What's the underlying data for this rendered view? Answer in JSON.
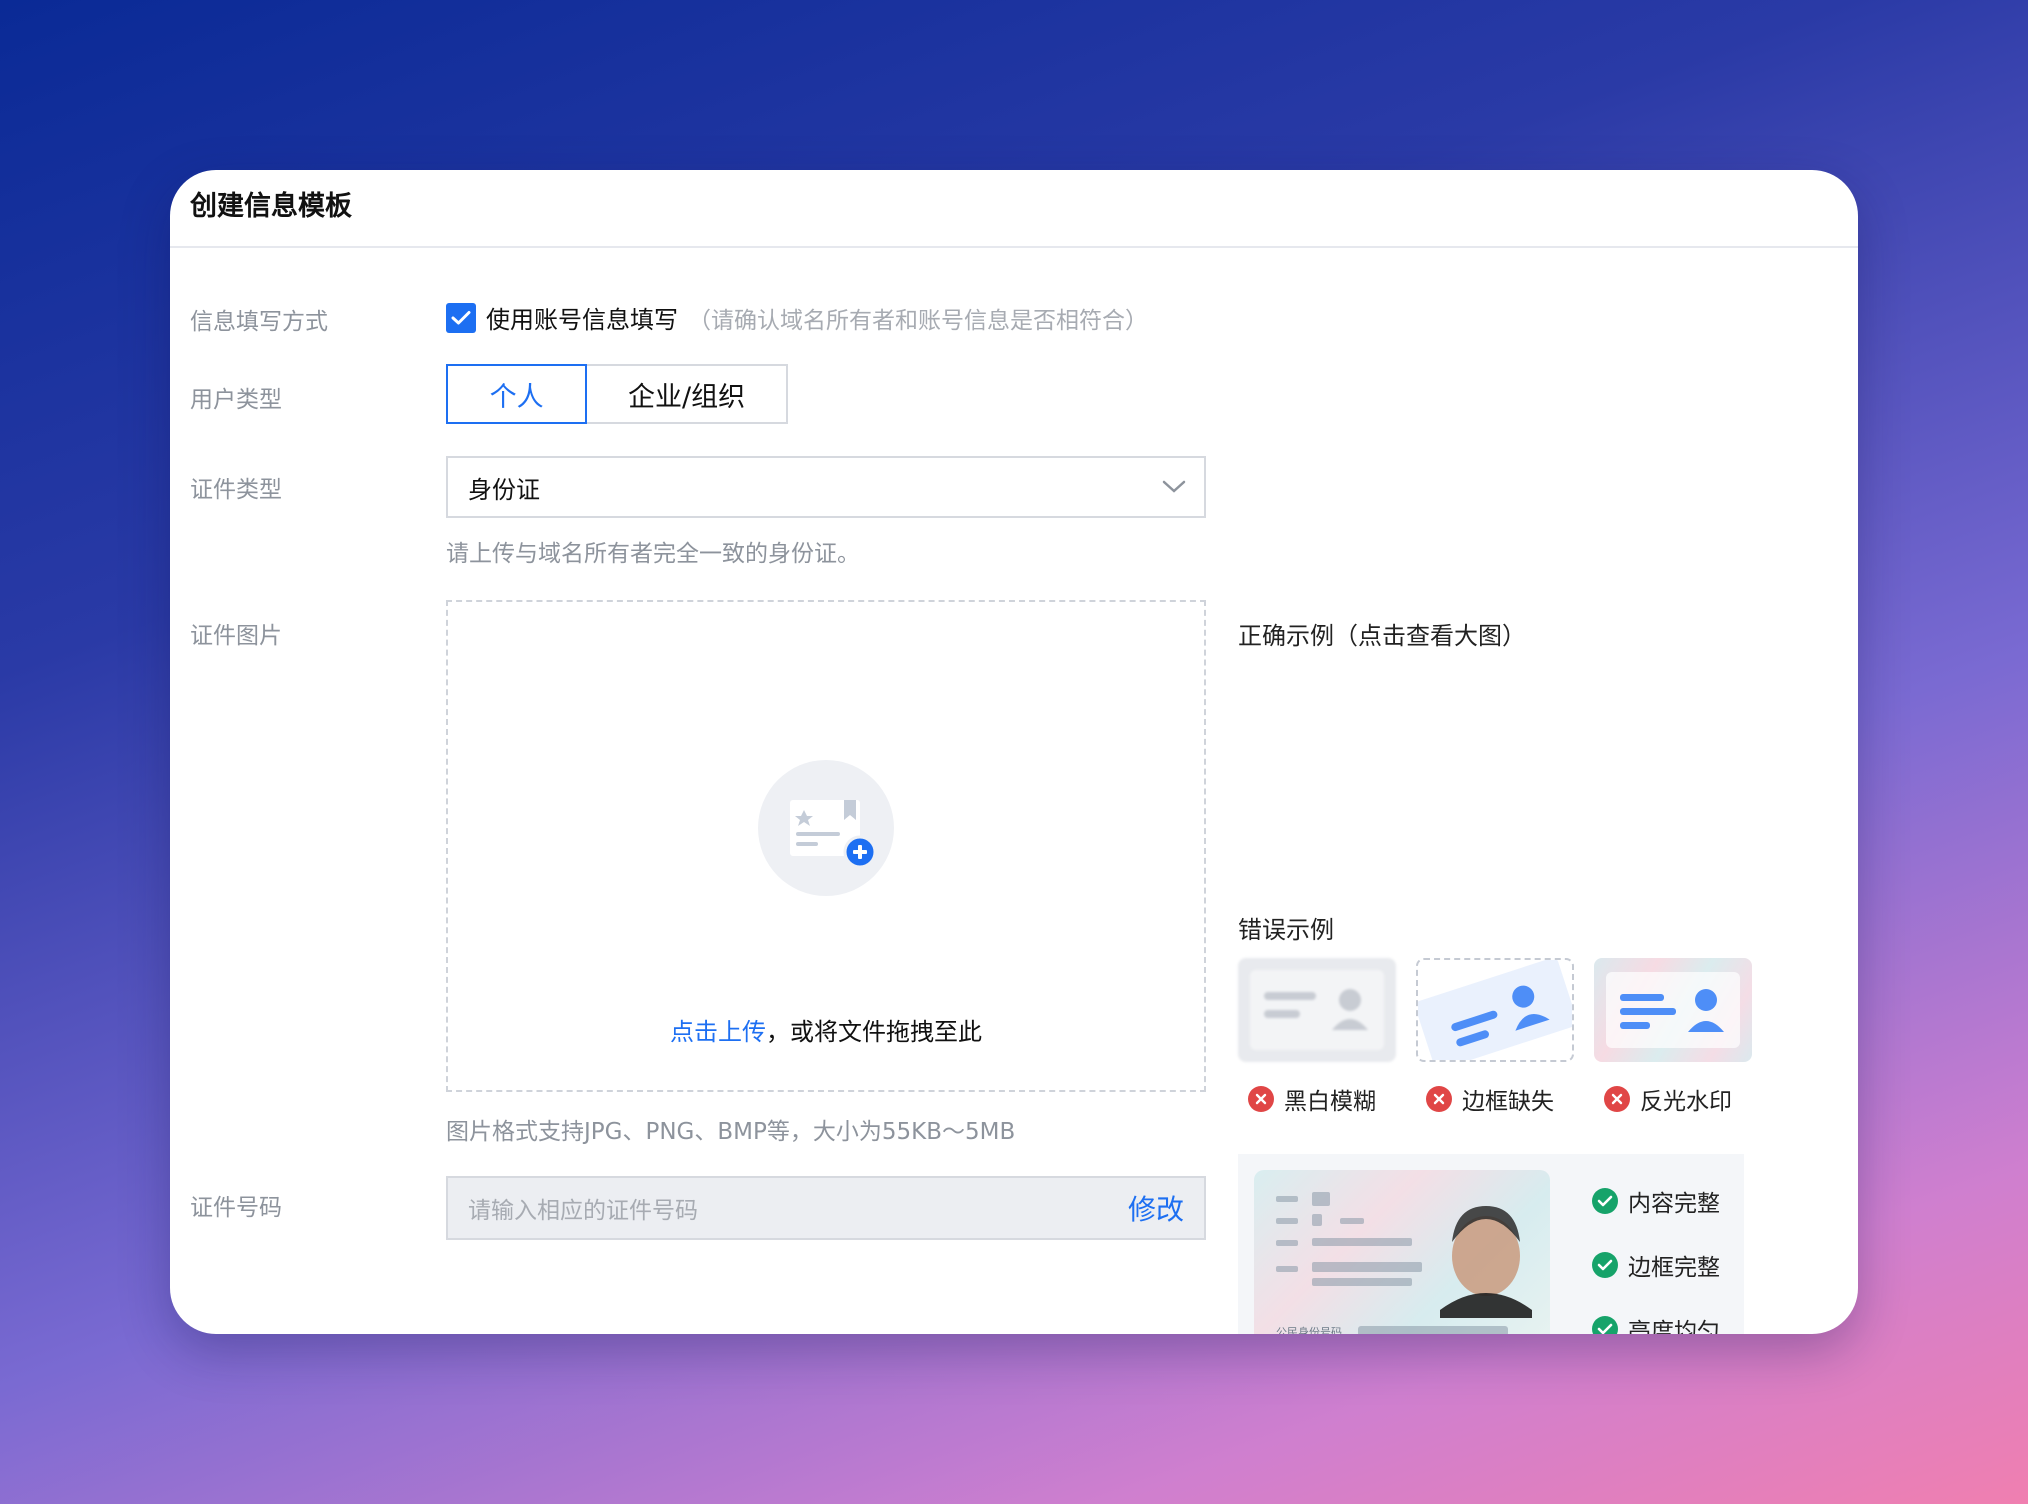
{
  "dialog": {
    "title": "创建信息模板"
  },
  "form": {
    "fill_method": {
      "label": "信息填写方式",
      "checkbox_label": "使用账号信息填写",
      "checkbox_hint": "（请确认域名所有者和账号信息是否相符合）",
      "checked": true
    },
    "user_type": {
      "label": "用户类型",
      "options": [
        "个人",
        "企业/组织"
      ],
      "selected": "个人"
    },
    "cert_type": {
      "label": "证件类型",
      "value": "身份证",
      "hint": "请上传与域名所有者完全一致的身份证。"
    },
    "cert_image": {
      "label": "证件图片",
      "upload_link": "点击上传",
      "upload_text": "，或将文件拖拽至此",
      "hint": "图片格式支持JPG、PNG、BMP等，大小为55KB～5MB"
    },
    "cert_number": {
      "label": "证件号码",
      "placeholder": "请输入相应的证件号码",
      "action": "修改"
    }
  },
  "examples": {
    "correct_title": "正确示例（点击查看大图）",
    "correct_items": [
      "内容完整",
      "边框完整",
      "亮度均匀"
    ],
    "idcard_caption": "公民身份号码",
    "error_title": "错误示例",
    "error_items": [
      "黑白模糊",
      "边框缺失",
      "反光水印"
    ]
  },
  "colors": {
    "accent": "#1d6ff2",
    "success": "#16a36a",
    "error": "#e04646"
  }
}
